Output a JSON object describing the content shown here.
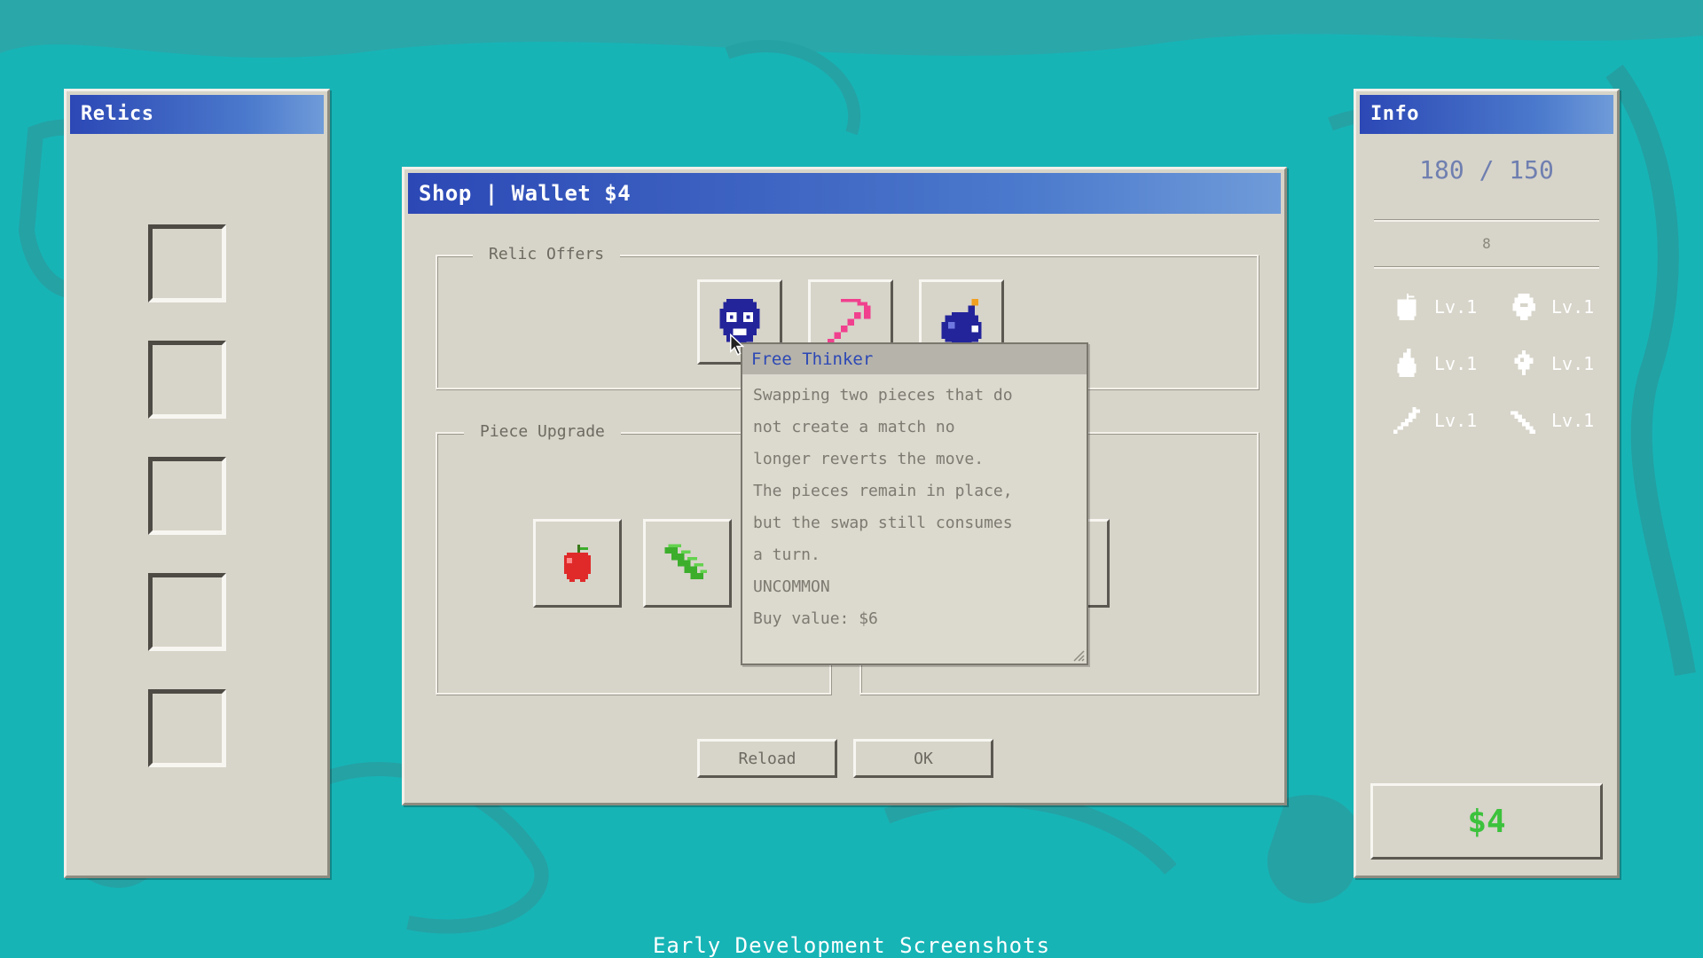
{
  "relics_panel": {
    "title": "Relics",
    "slot_count": 5
  },
  "shop": {
    "title": "Shop | Wallet $4",
    "relic_offers_label": "Relic Offers",
    "relic_offers": [
      {
        "icon": "thinker-head-icon"
      },
      {
        "icon": "pickaxe-icon"
      },
      {
        "icon": "bomb-icon"
      }
    ],
    "piece_upgrade_label": "Piece Upgrade",
    "piece_upgrades": [
      {
        "icon": "apple-icon"
      },
      {
        "icon": "leaf-icon"
      }
    ],
    "buttons": {
      "reload": "Reload",
      "ok": "OK"
    }
  },
  "tooltip": {
    "title": "Free Thinker",
    "lines": [
      "Swapping two pieces that do",
      "not create a match no",
      "longer reverts the move.",
      "The pieces remain in place,",
      "but the swap still consumes",
      "a turn."
    ],
    "rarity": "UNCOMMON",
    "buy_value": "Buy value: $6"
  },
  "info_panel": {
    "title": "Info",
    "score": "180 / 150",
    "sub_value": "8",
    "stats": [
      {
        "icon": "apple-icon",
        "level": "Lv.1"
      },
      {
        "icon": "gem-icon",
        "level": "Lv.1"
      },
      {
        "icon": "pear-icon",
        "level": "Lv.1"
      },
      {
        "icon": "diamond-icon",
        "level": "Lv.1"
      },
      {
        "icon": "carrot-icon",
        "level": "Lv.1"
      },
      {
        "icon": "crystal-icon",
        "level": "Lv.1"
      }
    ],
    "money": "$4"
  },
  "caption": "Early Development Screenshots",
  "colors": {
    "background": "#16b3b5",
    "titlebar": "#2c48b5",
    "money": "#3cc23c",
    "tooltip_title": "#2c48b5"
  }
}
